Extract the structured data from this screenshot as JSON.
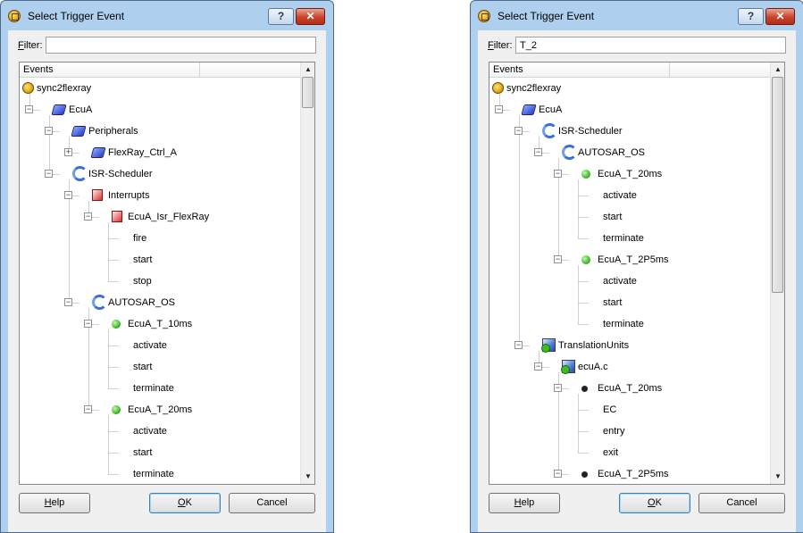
{
  "dialogs": [
    {
      "title": "Select Trigger Event",
      "help_glyph": "?",
      "close_glyph": "✕",
      "filter": {
        "label_key": "F",
        "label_rest": "ilter:",
        "value": ""
      },
      "columns": [
        "Events",
        ""
      ],
      "scroll_thumb_fraction": [
        0.0,
        0.08
      ],
      "tree": [
        {
          "label": "sync2flexray",
          "icon": "app-icon",
          "depth": 0,
          "expander": "none"
        },
        {
          "label": "EcuA",
          "icon": "ecu-icon",
          "depth": 1,
          "expander": "minus"
        },
        {
          "label": "Peripherals",
          "icon": "ecu-icon",
          "depth": 2,
          "expander": "minus"
        },
        {
          "label": "FlexRay_Ctrl_A",
          "icon": "ecu-icon",
          "depth": 3,
          "expander": "plus"
        },
        {
          "label": "ISR-Scheduler",
          "icon": "scheduler-icon",
          "depth": 2,
          "expander": "minus"
        },
        {
          "label": "Interrupts",
          "icon": "interrupt-icon",
          "depth": 3,
          "expander": "minus"
        },
        {
          "label": "EcuA_Isr_FlexRay",
          "icon": "interrupt-icon",
          "depth": 4,
          "expander": "minus"
        },
        {
          "label": "fire",
          "icon": "",
          "depth": 5,
          "expander": "none"
        },
        {
          "label": "start",
          "icon": "",
          "depth": 5,
          "expander": "none"
        },
        {
          "label": "stop",
          "icon": "",
          "depth": 5,
          "expander": "none"
        },
        {
          "label": "AUTOSAR_OS",
          "icon": "scheduler-icon",
          "depth": 3,
          "expander": "minus"
        },
        {
          "label": "EcuA_T_10ms",
          "icon": "task-icon",
          "depth": 4,
          "expander": "minus"
        },
        {
          "label": "activate",
          "icon": "",
          "depth": 5,
          "expander": "none"
        },
        {
          "label": "start",
          "icon": "",
          "depth": 5,
          "expander": "none"
        },
        {
          "label": "terminate",
          "icon": "",
          "depth": 5,
          "expander": "none"
        },
        {
          "label": "EcuA_T_20ms",
          "icon": "task-icon",
          "depth": 4,
          "expander": "minus"
        },
        {
          "label": "activate",
          "icon": "",
          "depth": 5,
          "expander": "none"
        },
        {
          "label": "start",
          "icon": "",
          "depth": 5,
          "expander": "none"
        },
        {
          "label": "terminate",
          "icon": "",
          "depth": 5,
          "expander": "none"
        }
      ],
      "buttons": {
        "help": {
          "key": "H",
          "rest": "elp"
        },
        "ok": {
          "key": "O",
          "rest": "K"
        },
        "cancel": {
          "label": "Cancel"
        }
      }
    },
    {
      "title": "Select Trigger Event",
      "help_glyph": "?",
      "close_glyph": "✕",
      "filter": {
        "label_key": "F",
        "label_rest": "ilter:",
        "value": "T_2"
      },
      "columns": [
        "Events",
        ""
      ],
      "scroll_thumb_fraction": [
        0.0,
        0.55
      ],
      "tree": [
        {
          "label": "sync2flexray",
          "icon": "app-icon",
          "depth": 0,
          "expander": "none"
        },
        {
          "label": "EcuA",
          "icon": "ecu-icon",
          "depth": 1,
          "expander": "minus"
        },
        {
          "label": "ISR-Scheduler",
          "icon": "scheduler-icon",
          "depth": 2,
          "expander": "minus"
        },
        {
          "label": "AUTOSAR_OS",
          "icon": "scheduler-icon",
          "depth": 3,
          "expander": "minus"
        },
        {
          "label": "EcuA_T_20ms",
          "icon": "task-icon",
          "depth": 4,
          "expander": "minus"
        },
        {
          "label": "activate",
          "icon": "",
          "depth": 5,
          "expander": "none"
        },
        {
          "label": "start",
          "icon": "",
          "depth": 5,
          "expander": "none"
        },
        {
          "label": "terminate",
          "icon": "",
          "depth": 5,
          "expander": "none"
        },
        {
          "label": "EcuA_T_2P5ms",
          "icon": "task-icon",
          "depth": 4,
          "expander": "minus"
        },
        {
          "label": "activate",
          "icon": "",
          "depth": 5,
          "expander": "none"
        },
        {
          "label": "start",
          "icon": "",
          "depth": 5,
          "expander": "none"
        },
        {
          "label": "terminate",
          "icon": "",
          "depth": 5,
          "expander": "none"
        },
        {
          "label": "TranslationUnits",
          "icon": "translation-unit-icon",
          "depth": 2,
          "expander": "minus"
        },
        {
          "label": "ecuA.c",
          "icon": "translation-unit-icon",
          "depth": 3,
          "expander": "minus"
        },
        {
          "label": "EcuA_T_20ms",
          "icon": "function-icon",
          "depth": 4,
          "expander": "minus"
        },
        {
          "label": "EC",
          "icon": "",
          "depth": 5,
          "expander": "none"
        },
        {
          "label": "entry",
          "icon": "",
          "depth": 5,
          "expander": "none"
        },
        {
          "label": "exit",
          "icon": "",
          "depth": 5,
          "expander": "none"
        },
        {
          "label": "EcuA_T_2P5ms",
          "icon": "function-icon",
          "depth": 4,
          "expander": "minus"
        }
      ],
      "buttons": {
        "help": {
          "key": "H",
          "rest": "elp"
        },
        "ok": {
          "key": "O",
          "rest": "K"
        },
        "cancel": {
          "label": "Cancel"
        }
      }
    }
  ]
}
